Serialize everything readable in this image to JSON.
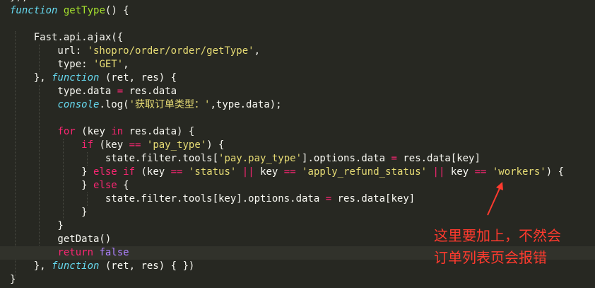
{
  "code_lines": [
    [
      {
        "t": "}",
        "c": "plain"
      },
      {
        "t": ");",
        "c": "plain"
      }
    ],
    [
      {
        "t": "function",
        "c": "kw"
      },
      {
        "t": " ",
        "c": "plain"
      },
      {
        "t": "getType",
        "c": "fn"
      },
      {
        "t": "() {",
        "c": "plain"
      }
    ],
    [],
    [
      {
        "t": "    Fast.api.ajax({",
        "c": "plain"
      }
    ],
    [
      {
        "t": "        url: ",
        "c": "plain"
      },
      {
        "t": "'shopro/order/order/getType'",
        "c": "str"
      },
      {
        "t": ",",
        "c": "plain"
      }
    ],
    [
      {
        "t": "        type: ",
        "c": "plain"
      },
      {
        "t": "'GET'",
        "c": "str"
      },
      {
        "t": ",",
        "c": "plain"
      }
    ],
    [
      {
        "t": "    }, ",
        "c": "plain"
      },
      {
        "t": "function",
        "c": "kw"
      },
      {
        "t": " (ret, res) {",
        "c": "plain"
      }
    ],
    [
      {
        "t": "        type.data ",
        "c": "plain"
      },
      {
        "t": "=",
        "c": "op"
      },
      {
        "t": " res.data",
        "c": "plain"
      }
    ],
    [
      {
        "t": "        ",
        "c": "plain"
      },
      {
        "t": "console",
        "c": "console"
      },
      {
        "t": ".log(",
        "c": "plain"
      },
      {
        "t": "'获取订单类型：'",
        "c": "str"
      },
      {
        "t": ",type.data);",
        "c": "plain"
      }
    ],
    [],
    [
      {
        "t": "        ",
        "c": "plain"
      },
      {
        "t": "for",
        "c": "ctrl"
      },
      {
        "t": " (key ",
        "c": "plain"
      },
      {
        "t": "in",
        "c": "ctrl"
      },
      {
        "t": " res.data) {",
        "c": "plain"
      }
    ],
    [
      {
        "t": "            ",
        "c": "plain"
      },
      {
        "t": "if",
        "c": "ctrl"
      },
      {
        "t": " (key ",
        "c": "plain"
      },
      {
        "t": "==",
        "c": "op"
      },
      {
        "t": " ",
        "c": "plain"
      },
      {
        "t": "'pay_type'",
        "c": "str"
      },
      {
        "t": ") {",
        "c": "plain"
      }
    ],
    [
      {
        "t": "                state.filter.tools[",
        "c": "plain"
      },
      {
        "t": "'pay.pay_type'",
        "c": "str"
      },
      {
        "t": "].options.data ",
        "c": "plain"
      },
      {
        "t": "=",
        "c": "op"
      },
      {
        "t": " res.data[key]",
        "c": "plain"
      }
    ],
    [
      {
        "t": "            } ",
        "c": "plain"
      },
      {
        "t": "else",
        "c": "ctrl"
      },
      {
        "t": " ",
        "c": "plain"
      },
      {
        "t": "if",
        "c": "ctrl"
      },
      {
        "t": " (key ",
        "c": "plain"
      },
      {
        "t": "==",
        "c": "op"
      },
      {
        "t": " ",
        "c": "plain"
      },
      {
        "t": "'status'",
        "c": "str"
      },
      {
        "t": " ",
        "c": "plain"
      },
      {
        "t": "||",
        "c": "op"
      },
      {
        "t": " key ",
        "c": "plain"
      },
      {
        "t": "==",
        "c": "op"
      },
      {
        "t": " ",
        "c": "plain"
      },
      {
        "t": "'apply_refund_status'",
        "c": "str"
      },
      {
        "t": " ",
        "c": "plain"
      },
      {
        "t": "||",
        "c": "op"
      },
      {
        "t": " key ",
        "c": "plain"
      },
      {
        "t": "==",
        "c": "op"
      },
      {
        "t": " ",
        "c": "plain"
      },
      {
        "t": "'workers'",
        "c": "str"
      },
      {
        "t": ") {",
        "c": "plain"
      }
    ],
    [
      {
        "t": "            } ",
        "c": "plain"
      },
      {
        "t": "else",
        "c": "ctrl"
      },
      {
        "t": " {",
        "c": "plain"
      }
    ],
    [
      {
        "t": "                state.filter.tools[key].options.data ",
        "c": "plain"
      },
      {
        "t": "=",
        "c": "op"
      },
      {
        "t": " res.data[key]",
        "c": "plain"
      }
    ],
    [
      {
        "t": "            }",
        "c": "plain"
      }
    ],
    [
      {
        "t": "        }",
        "c": "plain"
      }
    ],
    [
      {
        "t": "        getData()",
        "c": "plain"
      }
    ],
    [
      {
        "t": "        ",
        "c": "plain"
      },
      {
        "t": "return",
        "c": "ctrl"
      },
      {
        "t": " ",
        "c": "plain"
      },
      {
        "t": "false",
        "c": "bool"
      }
    ],
    [
      {
        "t": "    }, ",
        "c": "plain"
      },
      {
        "t": "function",
        "c": "kw"
      },
      {
        "t": " (ret, res) { })",
        "c": "plain"
      }
    ],
    [
      {
        "t": "}",
        "c": "plain"
      }
    ]
  ],
  "active_line_index": 19,
  "annotation": {
    "line1": "这里要加上，不然会",
    "line2": "订单列表页会报错",
    "color": "#ff3a2e"
  },
  "theme": {
    "background": "#272822",
    "keyword": "#66d9ef",
    "function_name": "#a6e22e",
    "string": "#e6db74",
    "operator": "#f92672",
    "boolean": "#ae81ff",
    "text": "#f8f8f2"
  }
}
